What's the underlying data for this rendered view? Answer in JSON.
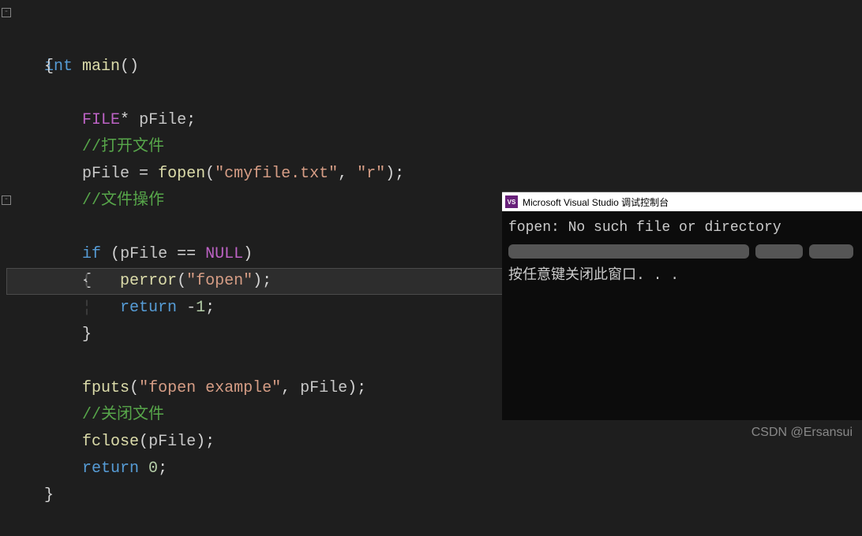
{
  "code": {
    "l1_int": "int",
    "l1_main": " main",
    "l1_parens": "()",
    "l2_brace": "{",
    "l4_type": "FILE",
    "l4_star": "* ",
    "l4_ident": "pFile",
    "l4_semi": ";",
    "l5_comment": "//打开文件",
    "l6_ident": "pFile ",
    "l6_eq": "= ",
    "l6_func": "fopen",
    "l6_open": "(",
    "l6_str1": "\"cmyfile.txt\"",
    "l6_comma": ", ",
    "l6_str2": "\"r\"",
    "l6_close": ")",
    "l6_semi": ";",
    "l7_comment": "//文件操作",
    "l8_if": "if ",
    "l8_open": "(",
    "l8_ident": "pFile ",
    "l8_eq": "== ",
    "l8_null": "NULL",
    "l8_close": ")",
    "l9_brace": "{",
    "l10_func": "perror",
    "l10_open": "(",
    "l10_str": "\"fopen\"",
    "l10_close": ")",
    "l10_semi": ";",
    "l11_return": "return ",
    "l11_neg": "-",
    "l11_num": "1",
    "l11_semi": ";",
    "l12_brace": "}",
    "l14_func": "fputs",
    "l14_open": "(",
    "l14_str": "\"fopen example\"",
    "l14_comma": ", ",
    "l14_ident": "pFile",
    "l14_close": ")",
    "l14_semi": ";",
    "l15_comment": "//关闭文件",
    "l16_func": "fclose",
    "l16_open": "(",
    "l16_ident": "pFile",
    "l16_close": ")",
    "l16_semi": ";",
    "l17_return": "return ",
    "l17_num": "0",
    "l17_semi": ";",
    "l18_brace": "}"
  },
  "console": {
    "title": "Microsoft Visual Studio 调试控制台",
    "icon_text": "VS",
    "line1": "fopen: No such file or directory",
    "line3": "按任意键关闭此窗口. . ."
  },
  "watermark": "CSDN @Ersansui",
  "indent1": "    ",
  "indent2": "        "
}
